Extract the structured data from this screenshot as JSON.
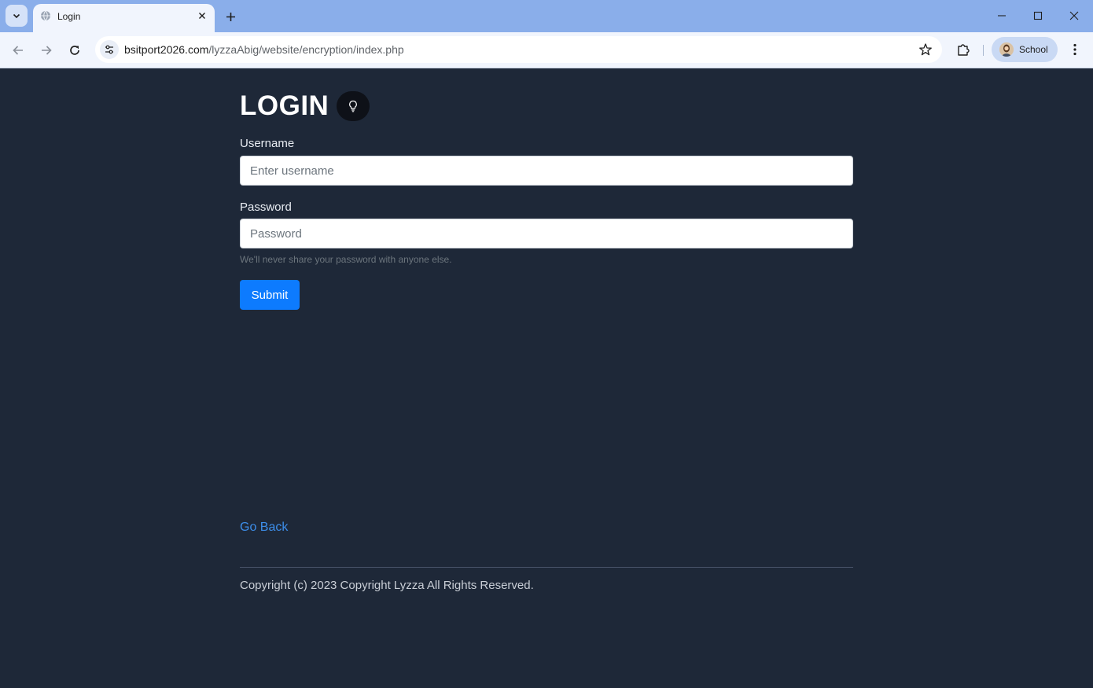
{
  "browser": {
    "tab": {
      "title": "Login"
    },
    "url": {
      "host": "bsitport2026.com",
      "path": "/lyzzaAbig/website/encryption/index.php"
    },
    "profile": {
      "name": "School"
    }
  },
  "page": {
    "title": "LOGIN",
    "username": {
      "label": "Username",
      "placeholder": "Enter username",
      "value": ""
    },
    "password": {
      "label": "Password",
      "placeholder": "Password",
      "value": ""
    },
    "help_text": "We'll never share your password with anyone else.",
    "submit_label": "Submit",
    "go_back_label": "Go Back",
    "copyright": "Copyright (c) 2023 Copyright Lyzza All Rights Reserved."
  },
  "colors": {
    "page_background": "#1e2838",
    "primary_button": "#0d7bfe",
    "link": "#3d8eea",
    "tabbar": "#8aaeea"
  },
  "icons": {
    "theme_toggle": "lightbulb-icon",
    "tab_favicon": "globe-icon"
  }
}
